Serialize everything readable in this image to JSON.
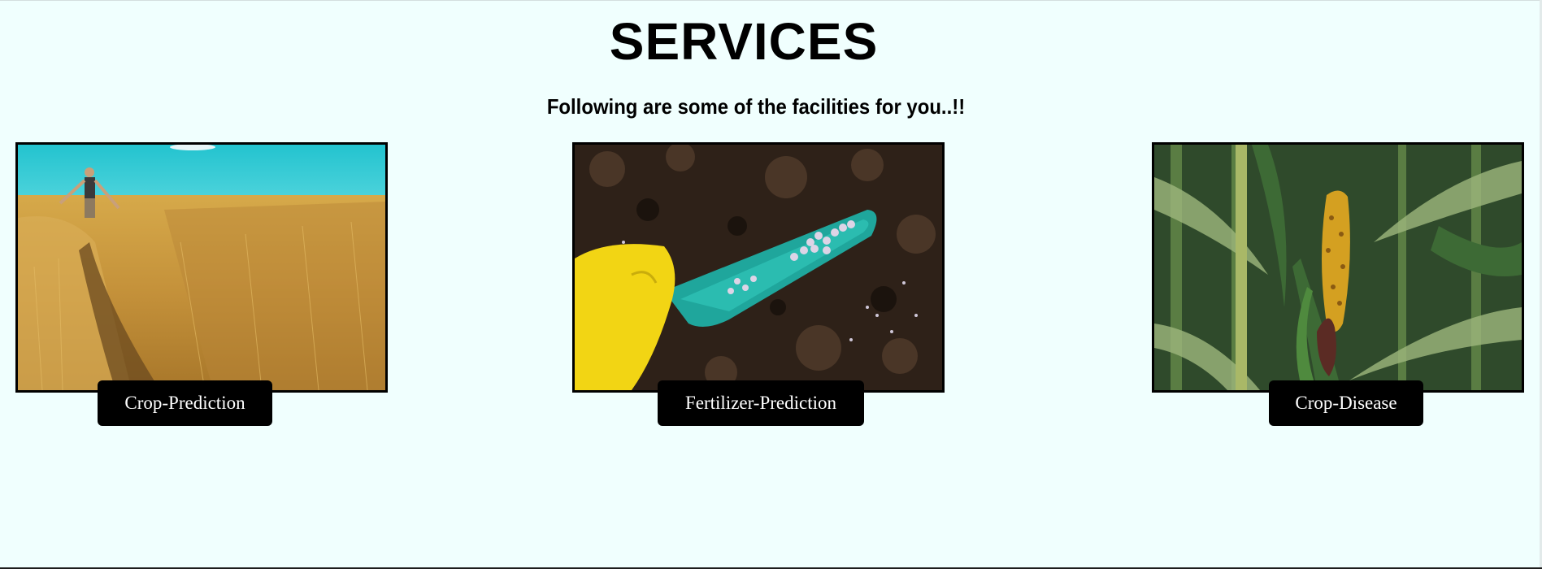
{
  "header": {
    "title": "SERVICES",
    "subtitle": "Following are some of the facilities for you..!!"
  },
  "services": [
    {
      "image": "wheat-field-farmer-photo",
      "label": "Crop-Prediction"
    },
    {
      "image": "fertilizer-scoop-soil-photo",
      "label": "Fertilizer-Prediction"
    },
    {
      "image": "diseased-corn-cob-photo",
      "label": "Crop-Disease"
    }
  ],
  "colors": {
    "background": "#f0fffe",
    "button_bg": "#000000",
    "button_text": "#ffffff",
    "image_border": "#000000"
  }
}
